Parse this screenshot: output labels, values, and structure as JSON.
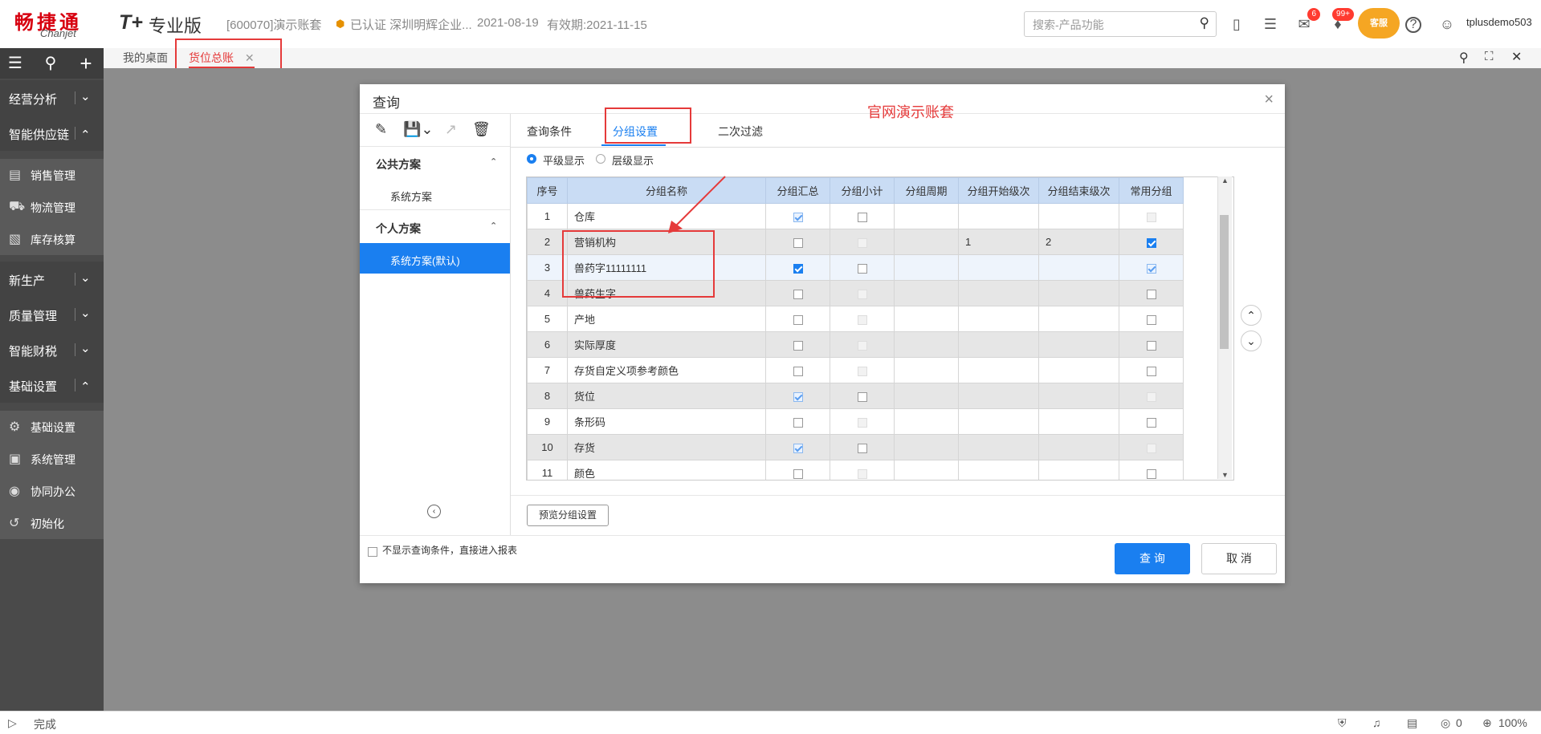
{
  "topbar": {
    "logo_cn": "畅捷通",
    "logo_en": "Chanjet",
    "product_mark": "T+",
    "edition": "专业版",
    "account": "[600070]演示账套",
    "certified": "已认证 深圳明辉企业...",
    "date": "2021-08-19",
    "valid": "有效期:2021-11-15",
    "search_placeholder": "搜索-产品功能",
    "badge_messages": "6",
    "badge_notices": "99+",
    "mascot_text": "客服",
    "username": "tplusdemo503"
  },
  "sidebar": {
    "groups": [
      {
        "label": "经营分析"
      },
      {
        "label": "智能供应链"
      },
      {
        "label": "新生产"
      },
      {
        "label": "质量管理"
      },
      {
        "label": "智能财税"
      },
      {
        "label": "基础设置"
      }
    ],
    "supply_items": [
      "销售管理",
      "物流管理",
      "库存核算"
    ],
    "base_items": [
      "基础设置",
      "系统管理",
      "协同办公",
      "初始化"
    ]
  },
  "tabs": {
    "home": "我的桌面",
    "active": "货位总账"
  },
  "dialog": {
    "title": "查询",
    "public_scheme": "公共方案",
    "public_item": "系统方案",
    "personal_scheme": "个人方案",
    "personal_item": "系统方案(默认)",
    "tabs": [
      "查询条件",
      "分组设置",
      "二次过滤"
    ],
    "annotation": "官网演示账套",
    "radio_flat": "平级显示",
    "radio_tree": "层级显示",
    "columns": [
      "序号",
      "分组名称",
      "分组汇总",
      "分组小计",
      "分组周期",
      "分组开始级次",
      "分组结束级次",
      "常用分组"
    ],
    "rows": [
      {
        "no": "1",
        "name": "仓库",
        "sum": "light",
        "sub": "off",
        "period": "",
        "start": "",
        "end": "",
        "common": "dis"
      },
      {
        "no": "2",
        "name": "营销机构",
        "sum": "off",
        "sub": "dis",
        "period": "",
        "start": "1",
        "end": "2",
        "common": "on"
      },
      {
        "no": "3",
        "name": "兽药字11111111",
        "sum": "on",
        "sub": "off",
        "period": "",
        "start": "",
        "end": "",
        "common": "light"
      },
      {
        "no": "4",
        "name": "兽药生字",
        "sum": "off",
        "sub": "dis",
        "period": "",
        "start": "",
        "end": "",
        "common": "off"
      },
      {
        "no": "5",
        "name": "产地",
        "sum": "off",
        "sub": "dis",
        "period": "",
        "start": "",
        "end": "",
        "common": "off"
      },
      {
        "no": "6",
        "name": "实际厚度",
        "sum": "off",
        "sub": "dis",
        "period": "",
        "start": "",
        "end": "",
        "common": "off"
      },
      {
        "no": "7",
        "name": "存货自定义项参考颜色",
        "sum": "off",
        "sub": "dis",
        "period": "",
        "start": "",
        "end": "",
        "common": "off"
      },
      {
        "no": "8",
        "name": "货位",
        "sum": "light",
        "sub": "off",
        "period": "",
        "start": "",
        "end": "",
        "common": "dis"
      },
      {
        "no": "9",
        "name": "条形码",
        "sum": "off",
        "sub": "dis",
        "period": "",
        "start": "",
        "end": "",
        "common": "off"
      },
      {
        "no": "10",
        "name": "存货",
        "sum": "light",
        "sub": "off",
        "period": "",
        "start": "",
        "end": "",
        "common": "dis"
      },
      {
        "no": "11",
        "name": "颜色",
        "sum": "off",
        "sub": "dis",
        "period": "",
        "start": "",
        "end": "",
        "common": "off"
      }
    ],
    "preview_btn": "预览分组设置",
    "skip_label": "不显示查询条件，直接进入报表",
    "query_btn": "查 询",
    "cancel_btn": "取 消"
  },
  "statusbar": {
    "status": "完成",
    "count": "0",
    "zoom": "100%"
  },
  "colors": {
    "brand_red": "#d7000f",
    "accent_blue": "#1a7ff0",
    "annotation_red": "#e53a3a"
  }
}
